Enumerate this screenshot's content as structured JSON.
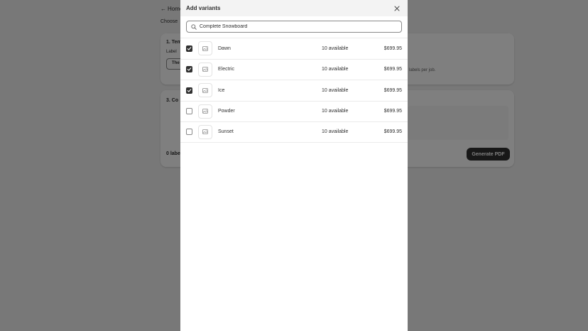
{
  "background": {
    "back_label": "Home",
    "crumb": "Choose",
    "step1_title": "1. Tem",
    "step1_label": "Label",
    "step1_select": "The",
    "per_job_text": "labels per job.",
    "step3_title": "3. Co",
    "count_text": "0 labe",
    "generate_label": "Generate PDF"
  },
  "modal": {
    "title": "Add variants",
    "close_icon": "close-icon",
    "search": {
      "value": "Complete Snowboard",
      "placeholder": "Search"
    },
    "variants": [
      {
        "name": "Dawn",
        "available": "10 available",
        "price": "$699.95",
        "checked": true
      },
      {
        "name": "Electric",
        "available": "10 available",
        "price": "$699.95",
        "checked": true
      },
      {
        "name": "Ice",
        "available": "10 available",
        "price": "$699.95",
        "checked": true
      },
      {
        "name": "Powder",
        "available": "10 available",
        "price": "$699.95",
        "checked": false
      },
      {
        "name": "Sunset",
        "available": "10 available",
        "price": "$699.95",
        "checked": false
      }
    ]
  },
  "colors": {
    "overlay": "#000000",
    "checkbox_checked": "#303030",
    "header_bg": "#f3f3f3"
  }
}
